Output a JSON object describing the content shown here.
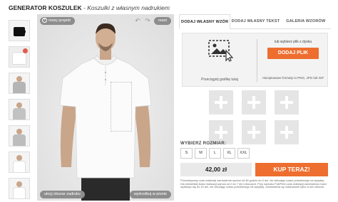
{
  "header": {
    "title": "GENERATOR KOSZULEK",
    "subtitle": " - Koszulki z własnym nadrukiem"
  },
  "product_thumbnails": [
    {
      "name": "mug",
      "color": "#111111"
    },
    {
      "name": "white-shirt",
      "color": "#ffffff"
    },
    {
      "name": "grey-hoodie-man",
      "color": "#b5b5b5"
    },
    {
      "name": "grey-sweatshirt-child",
      "color": "#c2c2c2"
    },
    {
      "name": "grey-sweatshirt-child-2",
      "color": "#bdbdbd"
    },
    {
      "name": "white-tee-child",
      "color": "#ffffff"
    },
    {
      "name": "white-tee-kid",
      "color": "#ffffff"
    }
  ],
  "canvas": {
    "new_project": "nowy projekt",
    "reset": "reset",
    "undo_icon": "undo-icon",
    "redo_icon": "redo-icon",
    "hide_area": "ukryj obszar zadruku",
    "center": "wyśrodkuj w pionie"
  },
  "tabs": [
    {
      "label": "DODAJ WŁASNY WZÓR",
      "active": true
    },
    {
      "label": "DODAJ WŁASNY TEKST",
      "active": false
    },
    {
      "label": "GALERIA WZORÓW",
      "active": false
    }
  ],
  "upload": {
    "drop_label": "Przeciągnij grafikę tutaj",
    "or_label": "lub wybierz plik z dysku",
    "button": "DODAJ PLIK",
    "formats": "Akceptowane formaty to PNG, JPG lub GIF"
  },
  "sizes": {
    "label": "WYBIERZ ROZMIAR:",
    "options": [
      "S",
      "M",
      "L",
      "XL",
      "XXL"
    ]
  },
  "price": "42,00 zł",
  "buy_button": "KUP TERAZ!",
  "note": "Przewidywany czas realizacji zamówienia wynosi od 48 godzin do 5 dni, nie wliczając czasu potrzebnego na wysyłkę. Dla niewielkiej ilości realizacji wynosi od 2 do 7 dni roboczych. Przy nadruku Full/Print czas realizacji zamówienia może wydłużyć się do 10 dni, nie wliczając czasu potrzebnego na wysyłkę. Zamówienia są realizowane tylko w dni robocze.",
  "colors": {
    "accent": "#ee6e2f",
    "pill": "#8d8d8d",
    "canvas_bg": "#e9e9e9"
  }
}
